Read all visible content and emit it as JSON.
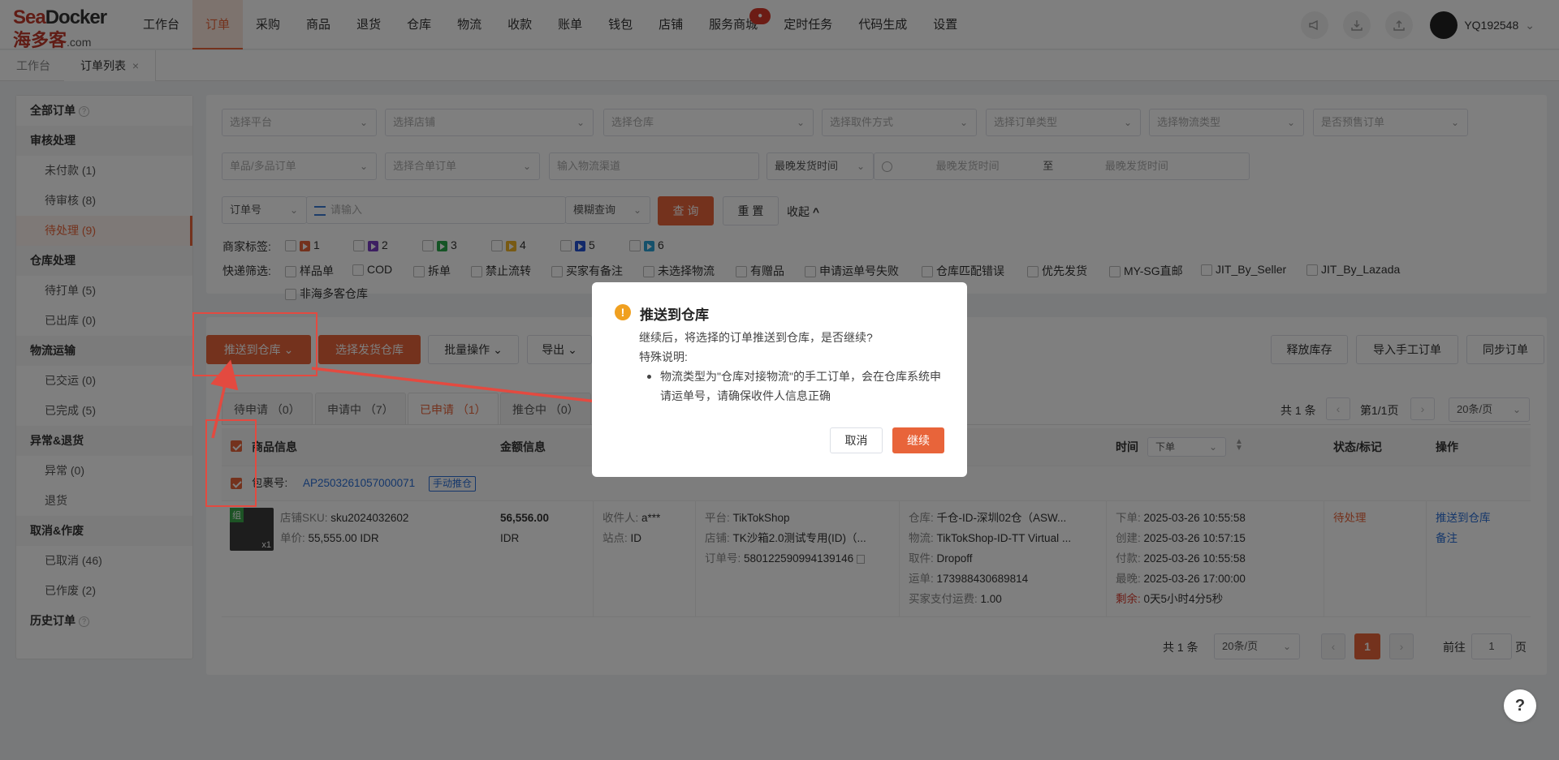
{
  "logo": {
    "en_a": "Sea",
    "en_b": "Docker",
    "cn": "海多客",
    "suffix": ".com"
  },
  "nav": [
    {
      "label": "工作台"
    },
    {
      "label": "订单",
      "active": true
    },
    {
      "label": "采购"
    },
    {
      "label": "商品"
    },
    {
      "label": "退货"
    },
    {
      "label": "仓库"
    },
    {
      "label": "物流"
    },
    {
      "label": "收款"
    },
    {
      "label": "账单"
    },
    {
      "label": "钱包"
    },
    {
      "label": "店铺"
    },
    {
      "label": "服务商城",
      "badge": "●"
    },
    {
      "label": "定时任务"
    },
    {
      "label": "代码生成"
    },
    {
      "label": "设置"
    }
  ],
  "user": {
    "name": "YQ192548",
    "caret": "⌄"
  },
  "page_tabs": [
    {
      "label": "工作台"
    },
    {
      "label": "订单列表",
      "close": "×"
    }
  ],
  "sidebar": {
    "all_orders": "全部订单",
    "groups": [
      {
        "title": "审核处理",
        "items": [
          "未付款 (1)",
          "待审核 (8)",
          "待处理 (9)"
        ]
      },
      {
        "title": "仓库处理",
        "items": [
          "待打单 (5)",
          "已出库 (0)"
        ]
      },
      {
        "title": "物流运输",
        "items": [
          "已交运 (0)",
          "已完成 (5)"
        ]
      },
      {
        "title": "异常&退货",
        "items": [
          "异常 (0)",
          "退货"
        ]
      },
      {
        "title": "取消&作废",
        "items": [
          "已取消 (46)",
          "已作废 (2)"
        ]
      }
    ],
    "history": "历史订单"
  },
  "filters": {
    "row1": [
      "选择平台",
      "选择店铺",
      "选择仓库",
      "选择取件方式",
      "选择订单类型",
      "选择物流类型",
      "是否预售订单"
    ],
    "row2_a": "单品/多品订单",
    "row2_b": "选择合单订单",
    "row2_c": "输入物流渠道",
    "time_type": "最晚发货时间",
    "time_start": "最晚发货时间",
    "time_to": "至",
    "time_end": "最晚发货时间",
    "order_no": "订单号",
    "search_placeholder": "请输入",
    "fuzzy": "模糊查询",
    "query": "查 询",
    "reset": "重 置",
    "collapse": "收起"
  },
  "merchant_tags": {
    "label": "商家标签:",
    "tags": [
      {
        "text": "1",
        "color": "#e8643a"
      },
      {
        "text": "2",
        "color": "#7b3fc4"
      },
      {
        "text": "3",
        "color": "#2aa84a"
      },
      {
        "text": "4",
        "color": "#f0b429"
      },
      {
        "text": "5",
        "color": "#2453d4"
      },
      {
        "text": "6",
        "color": "#2ba3d6"
      }
    ]
  },
  "quick_filter": {
    "label": "快递筛选:",
    "items": [
      "样品单",
      "COD",
      "拆单",
      "禁止流转",
      "买家有备注",
      "未选择物流",
      "有赠品",
      "申请运单号失败",
      "仓库匹配错误",
      "优先发货",
      "MY-SG直邮",
      "JIT_By_Seller",
      "JIT_By_Lazada"
    ],
    "item_row2": "非海多客仓库"
  },
  "actions": {
    "push_warehouse": "推送到仓库",
    "select_warehouse": "选择发货仓库",
    "batch": "批量操作",
    "export": "导出",
    "release_stock": "释放库存",
    "import_manual": "导入手工订单",
    "sync_orders": "同步订单"
  },
  "status_tabs": [
    {
      "label": "待申请 （0）"
    },
    {
      "label": "申请中 （7）"
    },
    {
      "label": "已申请 （1）",
      "active": true
    },
    {
      "label": "推仓中 （0）"
    }
  ],
  "pager_top": {
    "total": "共 1 条",
    "page": "第1/1页",
    "per_page": "20条/页"
  },
  "table_head": {
    "product": "商品信息",
    "amount": "金额信息",
    "time": "时间",
    "time_type": "下单",
    "status": "状态/标记",
    "ops": "操作"
  },
  "package": {
    "label": "包裹号:",
    "id": "AP2503261057000071",
    "tag": "手动推仓"
  },
  "order": {
    "img_badge": "组",
    "qty": "x1",
    "sku_k": "店铺SKU:",
    "sku": "sku2024032602",
    "price_k": "单价:",
    "price": "55,555.00 IDR",
    "amount": "56,556.00",
    "currency": "IDR",
    "receiver_k": "收件人:",
    "receiver": "a***",
    "site_k": "站点:",
    "site": "ID",
    "platform_k": "平台:",
    "platform": "TikTokShop",
    "shop_k": "店铺:",
    "shop": "TK沙箱2.0测试专用(ID)（...",
    "order_no_k": "订单号:",
    "order_no": "580122590994139146",
    "wh_k": "仓库:",
    "wh": "千仓-ID-深圳02仓（ASW...",
    "logi_k": "物流:",
    "logi": "TikTokShop-ID-TT Virtual ...",
    "pickup_k": "取件:",
    "pickup": "Dropoff",
    "waybill_k": "运单:",
    "waybill": "173988430689814",
    "freight_k": "买家支付运费:",
    "freight": "1.00",
    "t1_k": "下单:",
    "t1": "2025-03-26 10:55:58",
    "t2_k": "创建:",
    "t2": "2025-03-26 10:57:15",
    "t3_k": "付款:",
    "t3": "2025-03-26 10:55:58",
    "t4_k": "最晚:",
    "t4": "2025-03-26 17:00:00",
    "remain_k": "剩余:",
    "remain": "0天5小时4分5秒",
    "status": "待处理",
    "op1": "推送到仓库",
    "op2": "备注"
  },
  "pager_bottom": {
    "total": "共 1 条",
    "per_page": "20条/页",
    "current": "1",
    "goto": "前往",
    "goto_val": "1",
    "unit": "页"
  },
  "modal": {
    "icon": "!",
    "title": "推送到仓库",
    "line1": "继续后，将选择的订单推送到仓库，是否继续?",
    "line2": "特殊说明:",
    "bullet": "物流类型为\"仓库对接物流\"的手工订单，会在仓库系统申请运单号，请确保收件人信息正确",
    "cancel": "取消",
    "confirm": "继续"
  },
  "help": "?",
  "colors": {
    "accent": "#e8643a",
    "annotation": "#e34a40",
    "link": "#2a6fd6"
  }
}
